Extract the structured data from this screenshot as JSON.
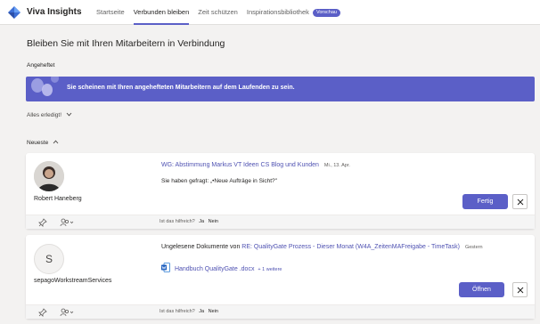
{
  "app": {
    "name": "Viva Insights"
  },
  "tabs": [
    {
      "label": "Startseite"
    },
    {
      "label": "Verbunden bleiben"
    },
    {
      "label": "Zeit schützen"
    },
    {
      "label": "Inspirationsbibliothek"
    }
  ],
  "preview_badge": "Vorschau",
  "page_title": "Bleiben Sie mit Ihren Mitarbeitern in Verbindung",
  "pinned": {
    "label": "Angeheftet",
    "banner_text": "Sie scheinen mit Ihren angehefteten Mitarbeitern auf dem Laufenden zu sein."
  },
  "filter": {
    "label": "Alles erledigt!"
  },
  "newest": {
    "label": "Neueste"
  },
  "cards": [
    {
      "person": "Robert Haneberg",
      "subject": "WG: Abstimmung Markus VT Ideen CS Blog und Kunden",
      "date": "Mi., 13. Apr.",
      "question": "Sie haben gefragt: „•Neue Aufträge in Sicht?\"",
      "action_label": "Fertig",
      "helpful_label": "Ist das hilfreich?",
      "yes": "Ja",
      "no": "Nein"
    },
    {
      "person": "sepagoWorkstreamServices",
      "initial": "S",
      "prefix": "Ungelesene Dokumente von",
      "subject": "RE: QualityGate Prozess - Dieser Monat (W4A_ZeitenMAFreigabe - TimeTask)",
      "date": "Gestern",
      "document": "Handbuch QualityGate .docx",
      "more": "+ 1 weitere",
      "action_label": "Öffnen",
      "helpful_label": "Ist das hilfreich?",
      "yes": "Ja",
      "no": "Nein"
    }
  ],
  "colors": {
    "accent": "#5b5fc7",
    "link": "#4f52b2",
    "background": "#f3f2f1"
  },
  "icons": [
    "viva-insights-logo-icon",
    "chevron-down-icon",
    "chevron-up-icon",
    "pin-icon",
    "people-icon",
    "close-icon",
    "word-document-icon"
  ]
}
